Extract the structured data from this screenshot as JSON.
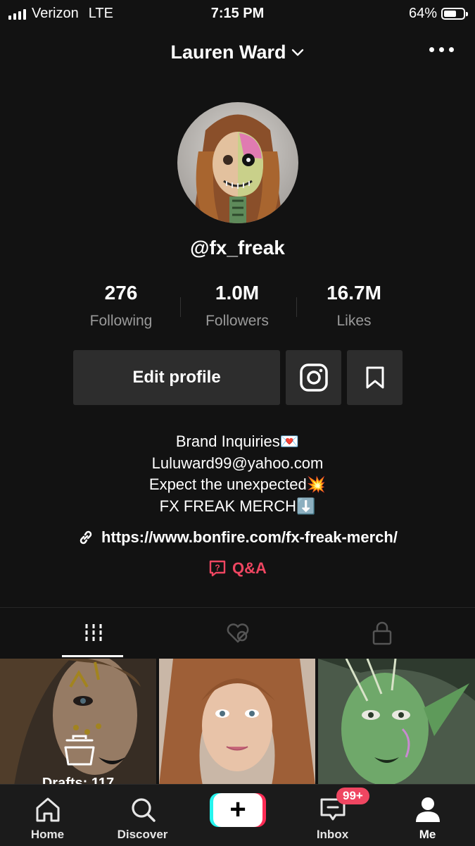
{
  "status_bar": {
    "carrier": "Verizon",
    "network": "LTE",
    "time": "7:15 PM",
    "battery": "64%",
    "battery_level": 0.64
  },
  "header": {
    "title": "Lauren Ward",
    "more_icon": "more-icon"
  },
  "profile": {
    "username": "@fx_freak"
  },
  "stats": [
    {
      "value": "276",
      "label": "Following"
    },
    {
      "value": "1.0M",
      "label": "Followers"
    },
    {
      "value": "16.7M",
      "label": "Likes"
    }
  ],
  "actions": {
    "edit_profile": "Edit profile",
    "instagram_icon": "instagram-icon",
    "bookmark_icon": "bookmark-icon"
  },
  "bio": {
    "lines": [
      "Brand Inquiries💌",
      "Luluward99@yahoo.com",
      "Expect the unexpected💥",
      "FX FREAK MERCH⬇️"
    ],
    "link": "https://www.bonfire.com/fx-freak-merch/",
    "qa": "Q&A"
  },
  "tabs": [
    "videos-grid-icon",
    "liked-hidden-icon",
    "lock-icon"
  ],
  "grid": {
    "drafts": "Drafts: 117"
  },
  "bottom_nav": {
    "home": "Home",
    "discover": "Discover",
    "create": "+",
    "inbox": "Inbox",
    "inbox_badge": "99+",
    "me": "Me"
  },
  "colors": {
    "background": "#121212",
    "accent": "#ef4661",
    "button": "#2d2d2d"
  }
}
